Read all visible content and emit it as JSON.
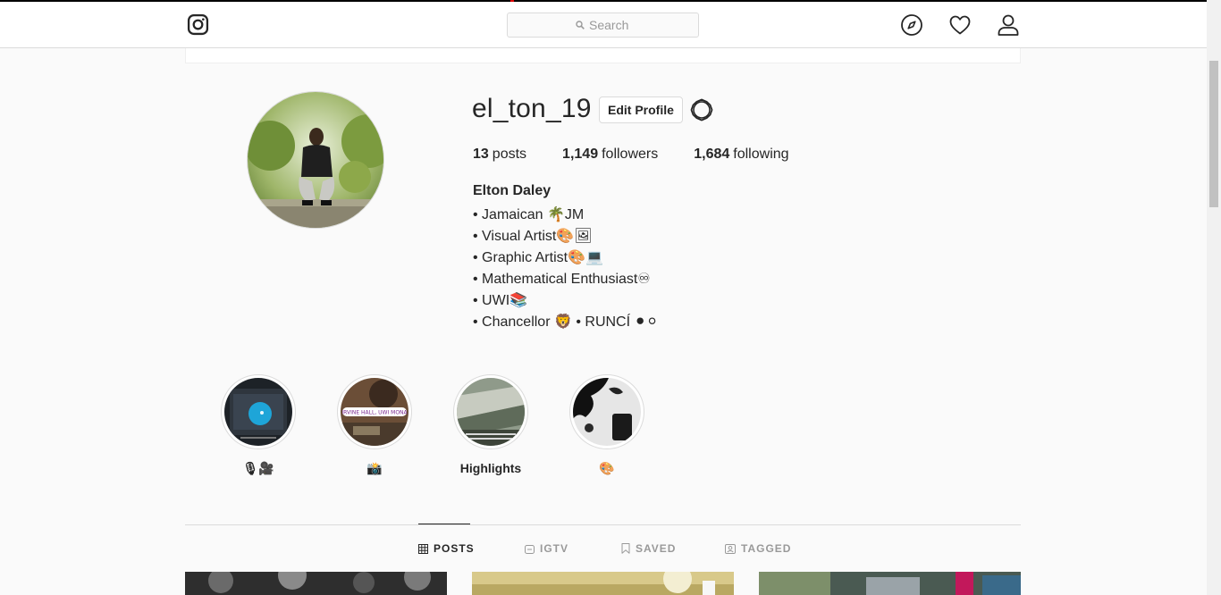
{
  "navbar": {
    "logo_icon": "instagram-camera-icon",
    "search_placeholder": "Search",
    "explore_icon": "compass-icon",
    "activity_icon": "heart-icon",
    "profile_icon": "person-icon"
  },
  "profile": {
    "username": "el_ton_19",
    "edit_label": "Edit Profile",
    "options_icon": "gear-icon",
    "stats": {
      "posts_count": "13",
      "posts_label": "posts",
      "followers_count": "1,149",
      "followers_label": "followers",
      "following_count": "1,684",
      "following_label": "following"
    },
    "full_name": "Elton Daley",
    "bio": [
      "• Jamaican 🌴JM",
      "• Visual Artist🎨🖼",
      "• Graphic Artist🎨💻",
      "• Mathematical Enthusiast♾",
      "• UWI📚",
      "• Chancellor 🦁 • RUNCÍ ⚫⚪"
    ]
  },
  "highlights": [
    {
      "label": "🎙🎥"
    },
    {
      "label": "📸",
      "overlay_text": "IRVINE HALL, UWI MONA"
    },
    {
      "label": "Highlights"
    },
    {
      "label": "🎨"
    }
  ],
  "tabs": [
    {
      "label": "POSTS",
      "icon": "grid-icon",
      "active": true
    },
    {
      "label": "IGTV",
      "icon": "igtv-icon",
      "active": false
    },
    {
      "label": "SAVED",
      "icon": "bookmark-icon",
      "active": false
    },
    {
      "label": "TAGGED",
      "icon": "tag-person-icon",
      "active": false
    }
  ],
  "colors": {
    "background": "#fafafa",
    "text": "#262626",
    "muted": "#999999",
    "border": "#dbdbdb"
  }
}
